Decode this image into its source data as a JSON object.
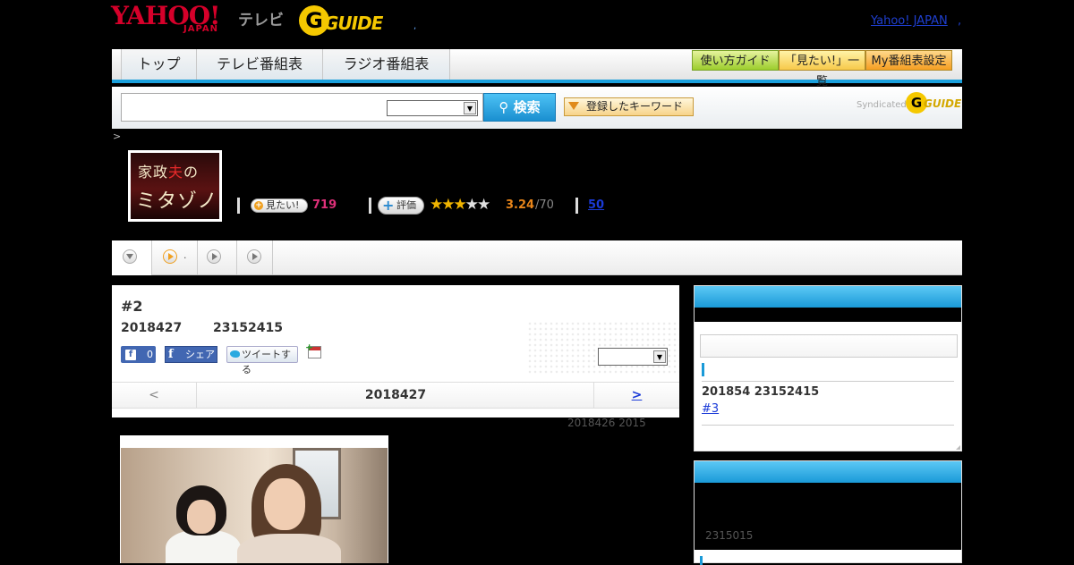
{
  "header": {
    "yahoo_logo": "YAHOO!",
    "japan_logo": "JAPAN",
    "tv_label": "テレビ",
    "gguide_logo": "GUIDE",
    "yahoo_japan_link": "Yahoo! JAPAN",
    "link_sep": ","
  },
  "nav": {
    "tabs": [
      "トップ",
      "テレビ番組表",
      "ラジオ番組表"
    ],
    "buttons": [
      "使い方ガイド",
      "「見たい!」一覧",
      "My番組表設定"
    ]
  },
  "search": {
    "input_value": "",
    "select_value": "",
    "button_label": "検索",
    "keyword_button": "登録したキーワード",
    "syndicated_label": "Syndicated",
    "syn_logo": "GUIDE"
  },
  "breadcrumb": ">",
  "program": {
    "image_title_line1_a": "家政",
    "image_title_line1_b": "夫",
    "image_title_line1_c": "の",
    "image_title_line2": "ミタゾノ",
    "mitai_label": "見たい!",
    "mitai_count": "719",
    "hyoka_label": "評価",
    "stars_on": 3,
    "stars_total": 5,
    "rating": "3.24",
    "rating_count": "/70",
    "review_count": "50"
  },
  "tabstrip": {
    "tab2_label": "."
  },
  "episode": {
    "title": "#2",
    "date": "2018427",
    "time": "23152415",
    "fb_like_count": "0",
    "fb_share_label": "シェア",
    "tweet_label": "ツイートする",
    "select_value": "",
    "nav_prev": "<",
    "nav_current": "2018427",
    "nav_next": ">",
    "broadcast_note": "2018426  2015"
  },
  "sidebar": {
    "next_date": "201854  23152415",
    "next_episode": "#3",
    "section2_time": "2315015"
  },
  "colors": {
    "accent_blue": "#1aa0dc",
    "yahoo_red": "#d6002a",
    "gguide_yellow": "#f5c800",
    "link_blue": "#1a3ad8"
  }
}
